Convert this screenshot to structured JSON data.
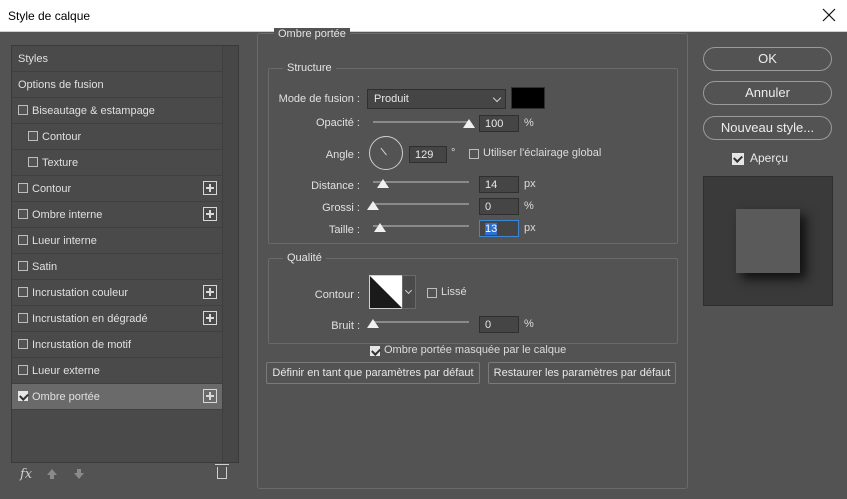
{
  "window": {
    "title": "Style de calque",
    "close_icon": "close-icon"
  },
  "left_list": [
    {
      "label": "Styles",
      "checkbox": false,
      "checked": false,
      "indent": false,
      "plus": false,
      "selected": false
    },
    {
      "label": "Options de fusion",
      "checkbox": false,
      "checked": false,
      "indent": false,
      "plus": false,
      "selected": false
    },
    {
      "label": "Biseautage & estampage",
      "checkbox": true,
      "checked": false,
      "indent": false,
      "plus": false,
      "selected": false
    },
    {
      "label": "Contour",
      "checkbox": true,
      "checked": false,
      "indent": true,
      "plus": false,
      "selected": false
    },
    {
      "label": "Texture",
      "checkbox": true,
      "checked": false,
      "indent": true,
      "plus": false,
      "selected": false
    },
    {
      "label": "Contour",
      "checkbox": true,
      "checked": false,
      "indent": false,
      "plus": true,
      "selected": false
    },
    {
      "label": "Ombre interne",
      "checkbox": true,
      "checked": false,
      "indent": false,
      "plus": true,
      "selected": false
    },
    {
      "label": "Lueur interne",
      "checkbox": true,
      "checked": false,
      "indent": false,
      "plus": false,
      "selected": false
    },
    {
      "label": "Satin",
      "checkbox": true,
      "checked": false,
      "indent": false,
      "plus": false,
      "selected": false
    },
    {
      "label": "Incrustation couleur",
      "checkbox": true,
      "checked": false,
      "indent": false,
      "plus": true,
      "selected": false
    },
    {
      "label": "Incrustation en dégradé",
      "checkbox": true,
      "checked": false,
      "indent": false,
      "plus": true,
      "selected": false
    },
    {
      "label": "Incrustation de motif",
      "checkbox": true,
      "checked": false,
      "indent": false,
      "plus": false,
      "selected": false
    },
    {
      "label": "Lueur externe",
      "checkbox": true,
      "checked": false,
      "indent": false,
      "plus": false,
      "selected": false
    },
    {
      "label": "Ombre portée",
      "checkbox": true,
      "checked": true,
      "indent": false,
      "plus": true,
      "selected": true
    }
  ],
  "bottom_tools": {
    "fx_label": "fx"
  },
  "panel": {
    "title": "Ombre portée",
    "structure": {
      "legend": "Structure",
      "blend_mode_label": "Mode de fusion :",
      "blend_mode_value": "Produit",
      "shadow_color": "#000000",
      "opacity_label": "Opacité :",
      "opacity_value": "100",
      "opacity_unit": "%",
      "opacity_level": 1.0,
      "angle_label": "Angle :",
      "angle_value": "129",
      "angle_unit": "°",
      "global_light_label": "Utiliser l'éclairage global",
      "global_light_checked": false,
      "distance_label": "Distance :",
      "distance_value": "14",
      "distance_unit": "px",
      "distance_level": 0.1,
      "spread_label": "Grossi :",
      "spread_value": "0",
      "spread_unit": "%",
      "spread_level": 0.0,
      "size_label": "Taille :",
      "size_value": "13",
      "size_unit": "px",
      "size_level": 0.07
    },
    "quality": {
      "legend": "Qualité",
      "contour_label": "Contour :",
      "antialias_label": "Lissé",
      "antialias_checked": false,
      "noise_label": "Bruit :",
      "noise_value": "0",
      "noise_unit": "%",
      "noise_level": 0.0
    },
    "knockout_label": "Ombre portée masquée par le calque",
    "knockout_checked": true,
    "make_default_label": "Définir en tant que paramètres par défaut",
    "reset_default_label": "Restaurer les paramètres par défaut"
  },
  "right": {
    "ok_label": "OK",
    "cancel_label": "Annuler",
    "new_style_label": "Nouveau style...",
    "preview_label": "Aperçu",
    "preview_checked": true
  }
}
